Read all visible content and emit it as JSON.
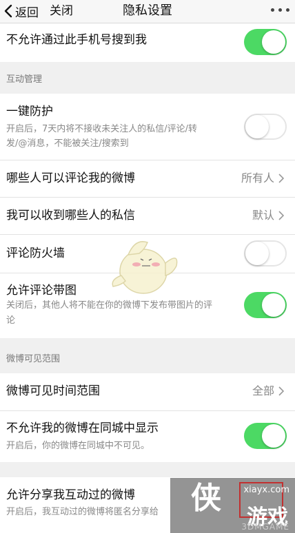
{
  "nav": {
    "back_label": "返回",
    "close_label": "关闭",
    "title": "隐私设置"
  },
  "rows": {
    "phone_search": {
      "title": "不允许通过此手机号搜到我",
      "toggle": "on"
    },
    "one_key_protect": {
      "title": "一键防护",
      "desc_line1": "开启后，7天内将不接收未关注人的私信/评论/转",
      "desc_line2": "发/@消息，不能被关注/搜索到",
      "toggle": "off"
    },
    "who_can_comment": {
      "title": "哪些人可以评论我的微博",
      "value": "所有人"
    },
    "receive_messages": {
      "title": "我可以收到哪些人的私信",
      "value": "默认"
    },
    "comment_firewall": {
      "title": "评论防火墙",
      "toggle": "off"
    },
    "comment_images": {
      "title": "允许评论带图",
      "desc_line1": "关闭后，其他人将不能在你的微博下发布带图片的评",
      "desc_line2": "论",
      "toggle": "on"
    },
    "visible_time_range": {
      "title": "微博可见时间范围",
      "value": "全部"
    },
    "same_city": {
      "title": "不允许我的微博在同城中显示",
      "desc": "开启后，你的微博在同城中不可见。",
      "toggle": "on"
    },
    "share_interacted": {
      "title": "允许分享我互动过的微博",
      "desc": "开启后，我互动过的微博将匿名分享给"
    }
  },
  "sections": {
    "interaction": "互动管理",
    "visibility": "微博可见范围"
  },
  "watermark": {
    "logo": "侠",
    "url": "xiayx.com",
    "brand": "游戏",
    "sub": "3DMGAME"
  },
  "colors": {
    "toggle_on": "#4cd964",
    "background": "#f0f0f0",
    "secondary_text": "#888888"
  }
}
